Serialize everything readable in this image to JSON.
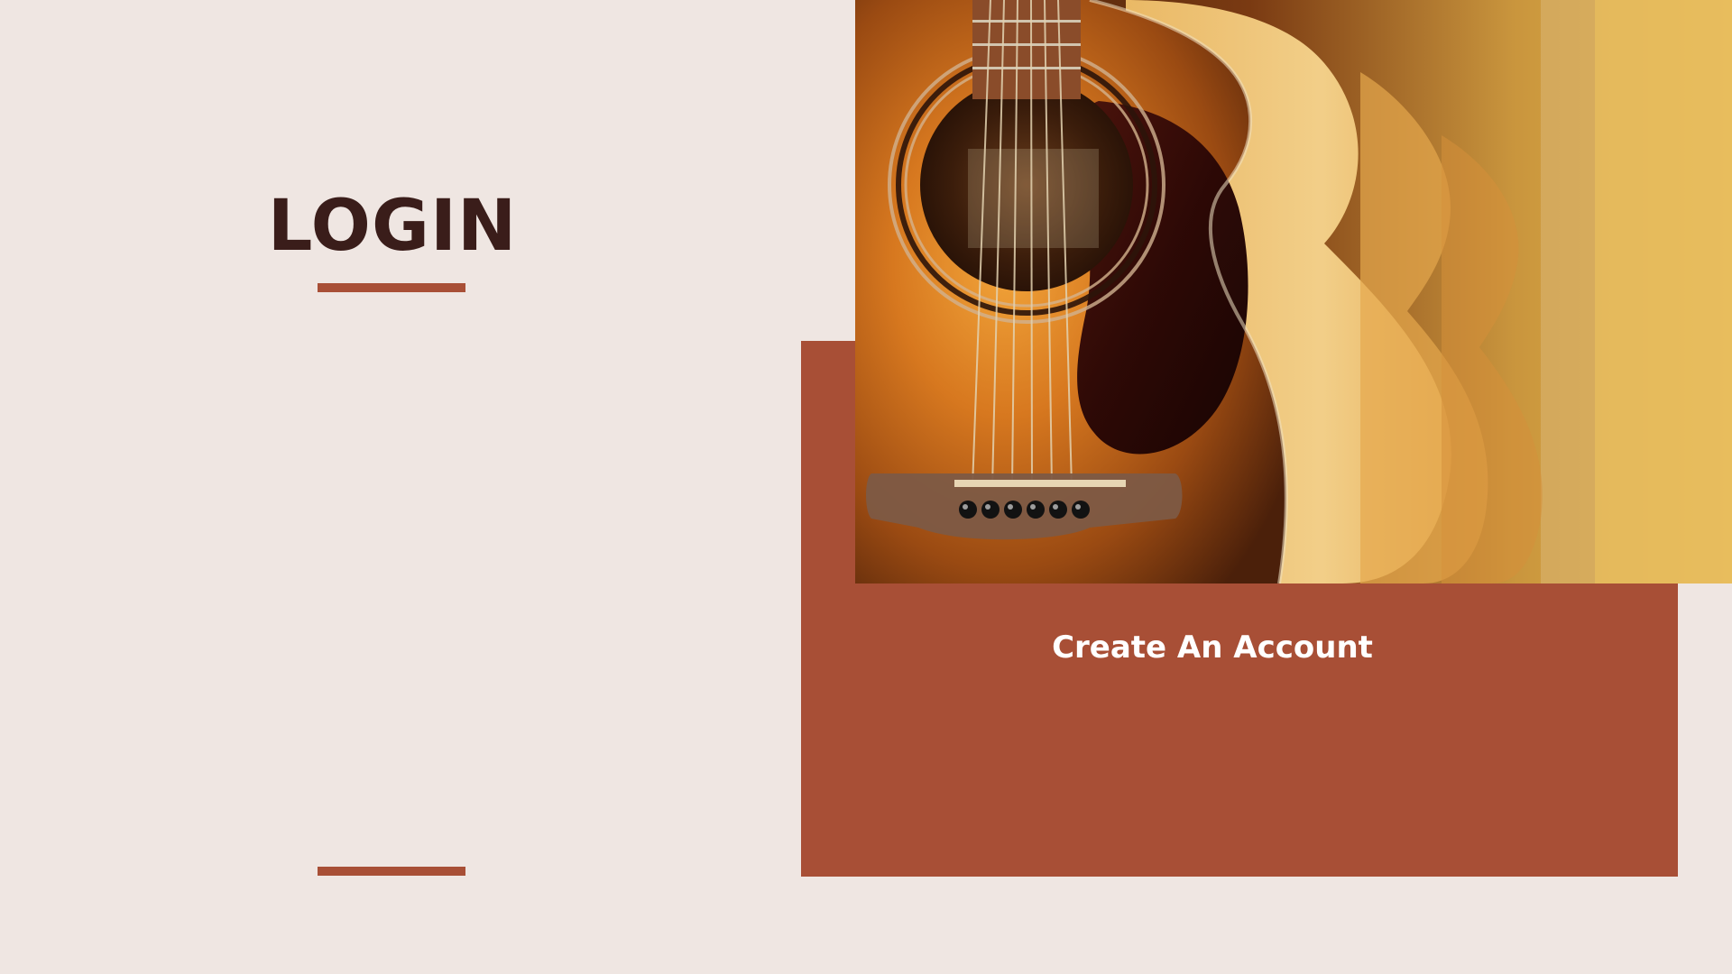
{
  "login": {
    "title": "LOGIN"
  },
  "actions": {
    "create_account_label": "Create An Account"
  },
  "photo": {
    "subject": "acoustic-guitar-photo"
  },
  "colors": {
    "background": "#EFE6E2",
    "accent": "#A84F36",
    "title": "#3A1D1A",
    "button_text": "#FFFFFF"
  }
}
